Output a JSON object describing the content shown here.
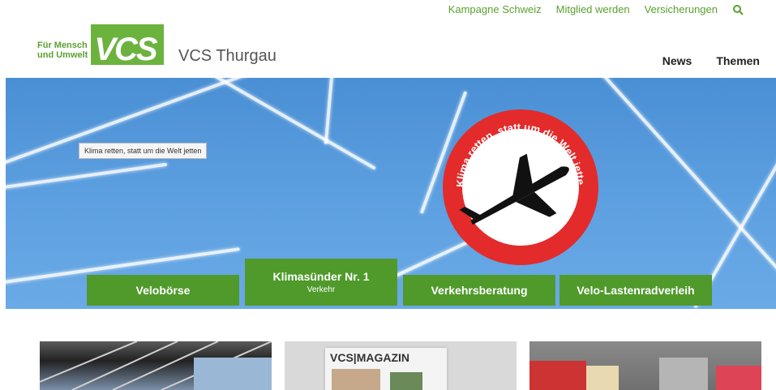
{
  "topnav": {
    "items": [
      "Kampagne Schweiz",
      "Mitglied werden",
      "Versicherungen"
    ]
  },
  "logo": {
    "claim_line1": "Für Mensch",
    "claim_line2": "und Umwelt",
    "mark": "VCS"
  },
  "site_name": "VCS Thurgau",
  "mainnav": {
    "items": [
      "News",
      "Themen"
    ]
  },
  "hero": {
    "tooltip": "Klima retten, statt um die Welt jetten",
    "sign_text": "Klima retten, statt um die Welt jetten"
  },
  "tiles": [
    {
      "label": "Velobörse"
    },
    {
      "label": "Klimasünder Nr. 1",
      "sub": "Verkehr"
    },
    {
      "label": "Verkehrsberatung"
    },
    {
      "label": "Velo-Lastenradverleih"
    }
  ],
  "cards": [
    {
      "magazine_title": ""
    },
    {
      "magazine_title": "VCS|MAGAZIN"
    },
    {
      "magazine_title": ""
    }
  ],
  "colors": {
    "accent": "#6cb33e",
    "tile": "#4f9a2b",
    "sky": "#5c9fe0",
    "sign_red": "#e32b2b"
  }
}
